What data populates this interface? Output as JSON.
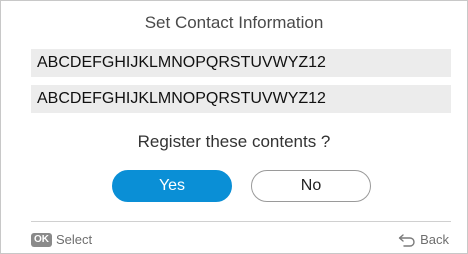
{
  "dialog": {
    "title": "Set Contact Information",
    "fields": [
      "ABCDEFGHIJKLMNOPQRSTUVWYZ12",
      "ABCDEFGHIJKLMNOPQRSTUVWYZ12"
    ],
    "prompt": "Register these contents ?",
    "yes_label": "Yes",
    "no_label": "No"
  },
  "footer": {
    "ok_badge": "OK",
    "select_label": "Select",
    "back_label": "Back",
    "ok_icon": "ok-button-icon",
    "back_icon": "return-arrow-icon"
  },
  "colors": {
    "accent": "#0a8fd6",
    "field_bg": "#ececec",
    "footer_text": "#6e6e6e"
  }
}
